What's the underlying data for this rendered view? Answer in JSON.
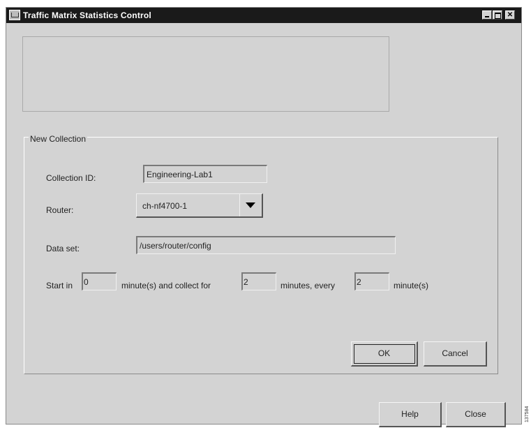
{
  "window": {
    "title": "Traffic Matrix Statistics Control",
    "icon": "window-menu-icon",
    "controls": [
      "minimize-icon",
      "maximize-icon",
      "close-icon"
    ],
    "close_glyph": "✕"
  },
  "group": {
    "legend": "New Collection"
  },
  "fields": {
    "collection_id": {
      "label": "Collection ID:",
      "value": "Engineering-Lab1"
    },
    "router": {
      "label": "Router:",
      "value": "ch-nf4700-1"
    },
    "data_set": {
      "label": "Data set:",
      "value": "/users/router/config"
    }
  },
  "schedule": {
    "start_label": "Start in",
    "start_value": "0",
    "collect_label": "minute(s) and collect for",
    "collect_value": "2",
    "every_label": "minutes, every",
    "every_value": "2",
    "unit_label": "minute(s)"
  },
  "buttons": {
    "ok": "OK",
    "cancel": "Cancel",
    "help": "Help",
    "close": "Close"
  },
  "edge_text": "137584"
}
